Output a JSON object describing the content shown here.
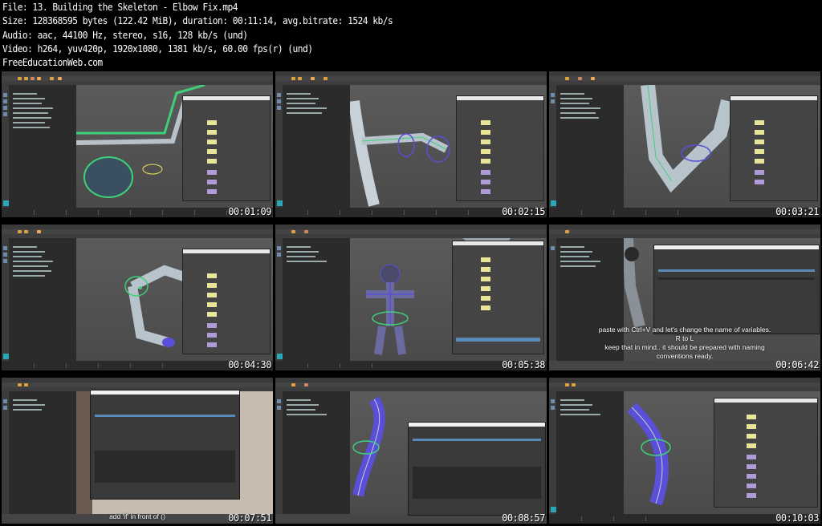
{
  "header": {
    "file": "File: 13. Building the Skeleton - Elbow Fix.mp4",
    "size": "Size: 128368595 bytes (122.42 MiB), duration: 00:11:14, avg.bitrate: 1524 kb/s",
    "audio": "Audio: aac, 44100 Hz, stereo, s16, 128 kb/s (und)",
    "video": "Video: h264, yuv420p, 1920x1080, 1381 kb/s, 60.00 fps(r) (und)",
    "site": "FreeEducationWeb.com"
  },
  "thumbnails": [
    {
      "timestamp": "00:01:09",
      "scene": "elbow-closeup"
    },
    {
      "timestamp": "00:02:15",
      "scene": "arm-side"
    },
    {
      "timestamp": "00:03:21",
      "scene": "elbow-top"
    },
    {
      "timestamp": "00:04:30",
      "scene": "arm-front"
    },
    {
      "timestamp": "00:05:38",
      "scene": "full-body"
    },
    {
      "timestamp": "00:06:42",
      "scene": "script-editor",
      "subtitle": [
        "paste with Ctrl+V and let's change the name of variables.",
        "R to L",
        "keep that in mind.. it should be prepared with naming",
        "conventions ready."
      ]
    },
    {
      "timestamp": "00:07:51",
      "scene": "script-dialog",
      "subtitle": [
        "add 'if' in front of ()"
      ]
    },
    {
      "timestamp": "00:08:57",
      "scene": "body-dialog"
    },
    {
      "timestamp": "00:10:03",
      "scene": "body-editor"
    }
  ],
  "colors": {
    "maya_bg": "#454545",
    "attr_yellow": "#e8e49a",
    "attr_purple": "#b09ad8",
    "wire_green": "#3fd07a",
    "joint_blue": "#5a4fd8"
  }
}
